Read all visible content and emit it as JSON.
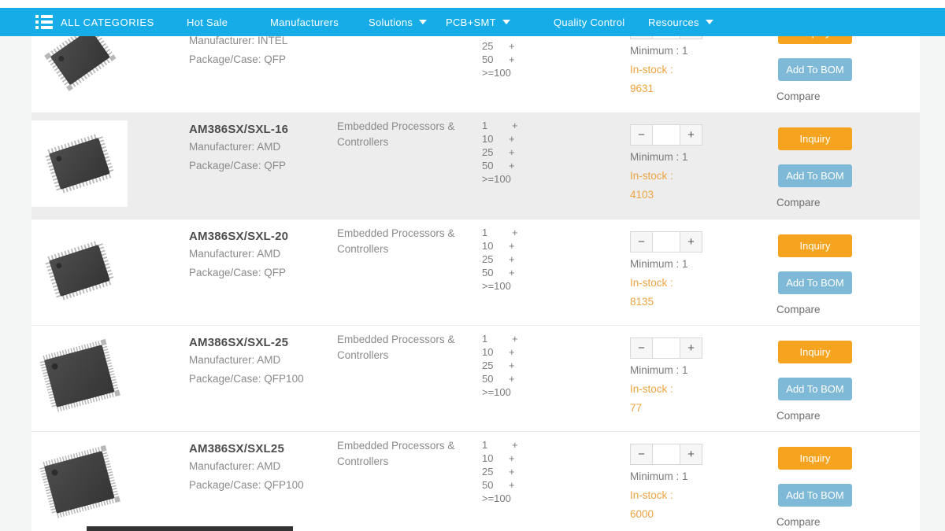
{
  "header": {
    "all_categories_label": "ALL CATEGORIES",
    "nav": [
      {
        "label": "Hot Sale",
        "has_dropdown": false
      },
      {
        "label": "Manufacturers",
        "has_dropdown": false
      },
      {
        "label": "Solutions",
        "has_dropdown": true
      },
      {
        "label": "PCB+SMT",
        "has_dropdown": true
      },
      {
        "label": "Quality Control",
        "has_dropdown": false
      },
      {
        "label": "Resources",
        "has_dropdown": true
      }
    ]
  },
  "tiers": [
    {
      "qty": "1",
      "plus": "+"
    },
    {
      "qty": "10",
      "plus": "+"
    },
    {
      "qty": "25",
      "plus": "+"
    },
    {
      "qty": "50",
      "plus": "+"
    },
    {
      "qty": ">=100",
      "plus": ""
    }
  ],
  "labels": {
    "minimum": "Minimum : 1",
    "in_stock": "In-stock :",
    "inquiry": "Inquiry",
    "add_to_bom": "Add To BOM",
    "compare": "Compare",
    "minus": "−",
    "plus": "+"
  },
  "products": [
    {
      "title": "",
      "manufacturer": "Manufacturer: INTEL",
      "package": "Package/Case: QFP",
      "category": "",
      "stock": "9631"
    },
    {
      "title": "AM386SX/SXL-16",
      "manufacturer": "Manufacturer: AMD",
      "package": "Package/Case: QFP",
      "category": "Embedded Processors & Controllers",
      "stock": "4103"
    },
    {
      "title": "AM386SX/SXL-20",
      "manufacturer": "Manufacturer: AMD",
      "package": "Package/Case: QFP",
      "category": "Embedded Processors & Controllers",
      "stock": "8135"
    },
    {
      "title": "AM386SX/SXL-25",
      "manufacturer": "Manufacturer: AMD",
      "package": "Package/Case: QFP100",
      "category": "Embedded Processors & Controllers",
      "stock": "77"
    },
    {
      "title": "AM386SX/SXL25",
      "manufacturer": "Manufacturer: AMD",
      "package": "Package/Case: QFP100",
      "category": "Embedded Processors & Controllers",
      "stock": "6000"
    }
  ],
  "colors": {
    "header_blue": "#15ace8",
    "inquiry_orange": "#f6a41f",
    "bom_blue": "#7eb9d8",
    "stock_orange": "#eda441",
    "row_highlight": "#ededed"
  }
}
